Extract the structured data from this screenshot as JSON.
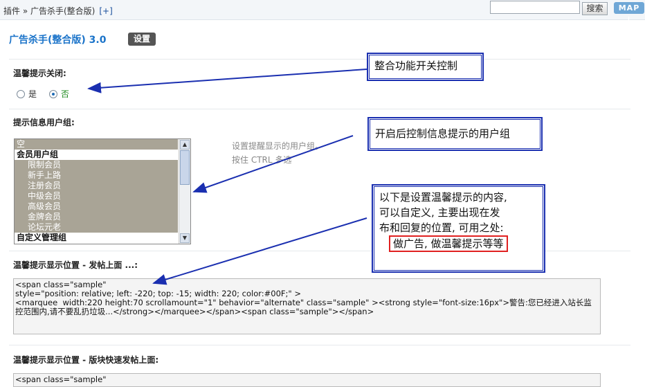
{
  "topbar": {
    "breadcrumb": "插件 » 广告杀手(整合版)",
    "breadcrumb_add": "[+]",
    "search_value": "",
    "search_button": "搜索",
    "map_button": "MAP ↓"
  },
  "page": {
    "title": "广告杀手(整合版) 3.0",
    "settings_button": "设置"
  },
  "section1": {
    "label": "温馨提示关闭:",
    "option_yes": "是",
    "option_no": "否",
    "selected": "否"
  },
  "section2": {
    "label": "提示信息用户组:",
    "hint_line1": "设置提醒显示的用户组。",
    "hint_line2": "按住 CTRL 多选",
    "items": [
      {
        "text": "空",
        "kind": "sel"
      },
      {
        "text": "会员用户组",
        "kind": "group"
      },
      {
        "text": "限制会员",
        "kind": "sel-sub"
      },
      {
        "text": "新手上路",
        "kind": "sel-sub"
      },
      {
        "text": "注册会员",
        "kind": "sel-sub"
      },
      {
        "text": "中级会员",
        "kind": "sel-sub"
      },
      {
        "text": "高级会员",
        "kind": "sel-sub"
      },
      {
        "text": "金牌会员",
        "kind": "sel-sub"
      },
      {
        "text": "论坛元老",
        "kind": "sel-sub"
      },
      {
        "text": "自定义管理组",
        "kind": "group"
      }
    ]
  },
  "section3": {
    "label": "温馨提示显示位置 - 发帖上面 ...:",
    "code": "<span class=\"sample\"\nstyle=\"position: relative; left: -220; top: -15; width: 220; color:#00F;\" >\n<marquee  width:220 height:70 scrollamount=\"1\" behavior=\"alternate\" class=\"sample\" ><strong style=\"font-size:16px\">警告:您已经进入站长监控范围内,请不要乱扔垃圾...</strong></marquee></span><span class=\"sample\"></span>"
  },
  "section4": {
    "label": "温馨提示显示位置 - 版块快速发帖上面:",
    "code": "<span class=\"sample\""
  },
  "callouts": {
    "c1": "整合功能开关控制",
    "c2": "开启后控制信息提示的用户组",
    "c3_line1": "以下是设置温馨提示的内容,",
    "c3_line2": "可以自定义, 主要出现在发",
    "c3_line3": "布和回复的位置, 可用之处:",
    "c3_highlight": "做广告, 做温馨提示等等"
  },
  "colors": {
    "title": "#1a73c9",
    "callout_border": "#1a2fb0",
    "highlight_border": "#e02020",
    "selected_bg": "#a9a496"
  }
}
